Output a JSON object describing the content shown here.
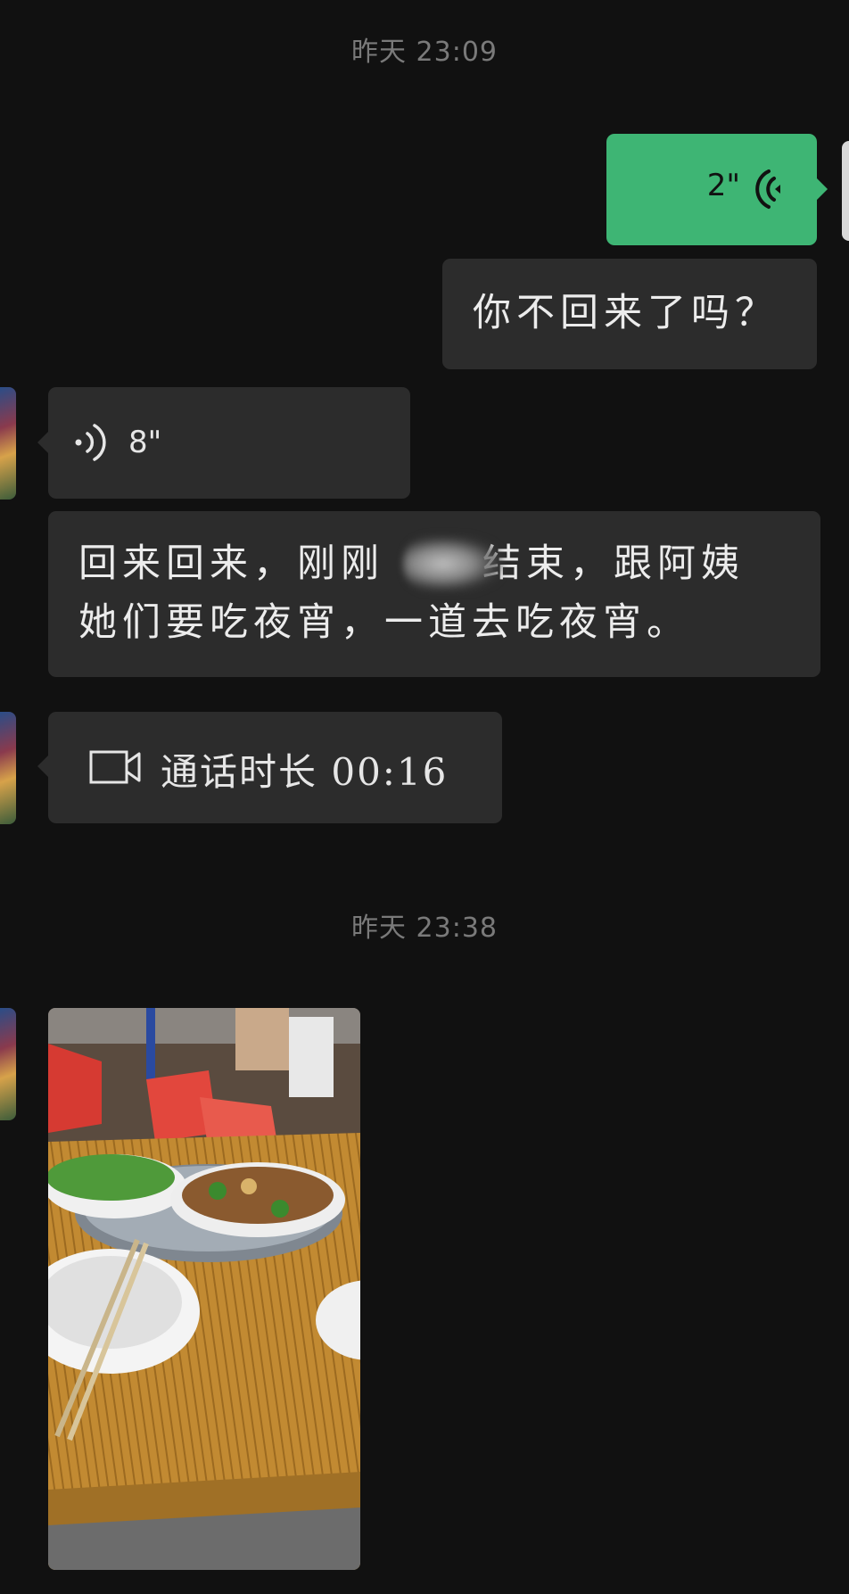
{
  "timestamps": [
    "昨天 23:09",
    "昨天 23:38"
  ],
  "messages": {
    "voice_out": {
      "duration": "2\""
    },
    "text_out": {
      "text": "你不回来了吗？"
    },
    "voice_in": {
      "duration": "8\""
    },
    "text_in": {
      "line1": "回来回来，刚刚",
      "line1b": "结束，跟阿姨",
      "line2": "她们要吃夜宵，一道去吃夜宵。"
    },
    "video_call": {
      "label": "通话时长 00:16"
    }
  },
  "icons": {
    "voice_out": "voice-waves-icon",
    "voice_in": "voice-waves-icon",
    "video_call": "video-camera-icon"
  },
  "colors": {
    "background": "#111111",
    "bubble_in": "#2c2c2c",
    "bubble_out": "#3eb574",
    "timestamp": "#7a7a7a"
  }
}
